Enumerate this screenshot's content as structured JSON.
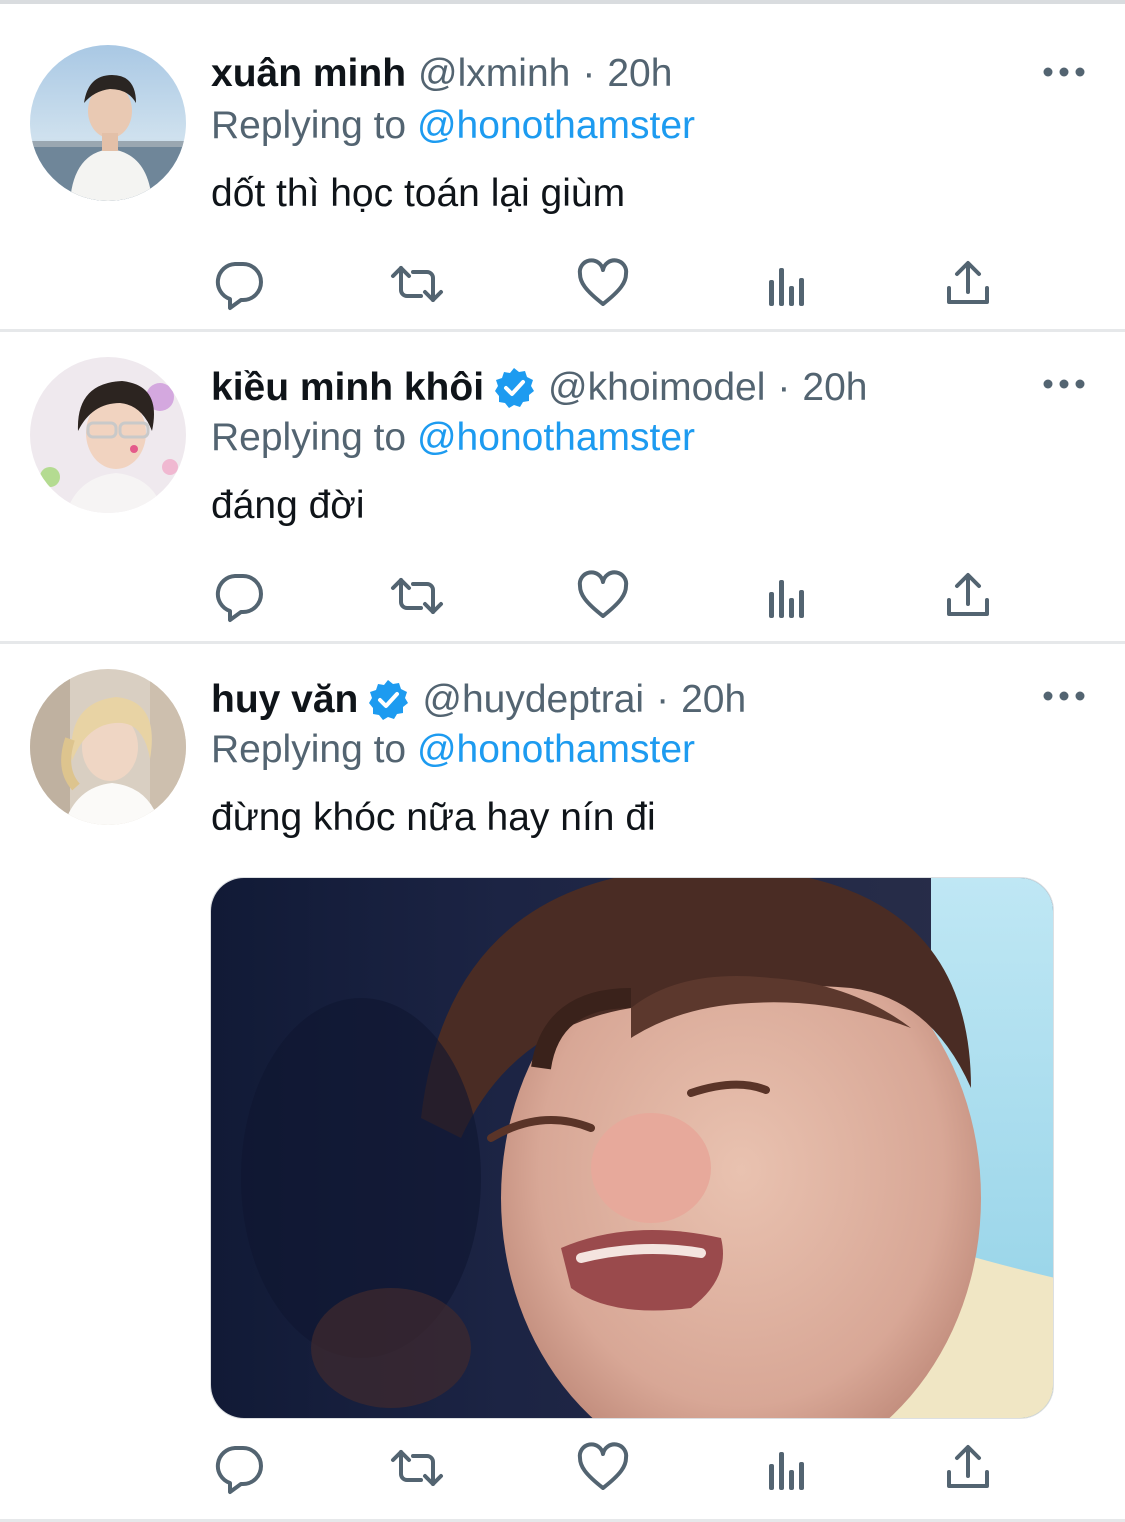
{
  "replies": [
    {
      "name": "xuân minh",
      "verified": false,
      "handle": "@lxminh",
      "separator": "·",
      "time": "20h",
      "replying_prefix": "Replying to",
      "replying_to": "@honothamster",
      "text": "dốt thì học toán lại giùm"
    },
    {
      "name": "kiều minh khôi",
      "verified": true,
      "handle": "@khoimodel",
      "separator": "·",
      "time": "20h",
      "replying_prefix": "Replying to",
      "replying_to": "@honothamster",
      "text": "đáng đời"
    },
    {
      "name": "huy văn",
      "verified": true,
      "handle": "@huydeptrai",
      "separator": "·",
      "time": "20h",
      "replying_prefix": "Replying to",
      "replying_to": "@honothamster",
      "text": "đừng khóc nữa hay nín đi",
      "has_media": true
    }
  ],
  "icons": {
    "reply": "reply-icon",
    "retweet": "retweet-icon",
    "like": "like-icon",
    "views": "views-icon",
    "share": "share-icon",
    "more": "more-icon",
    "verified": "verified-badge-icon"
  },
  "colors": {
    "link": "#1d9bf0",
    "secondary_text": "#536471",
    "primary_text": "#0f1419",
    "divider": "#e6e8ea"
  }
}
